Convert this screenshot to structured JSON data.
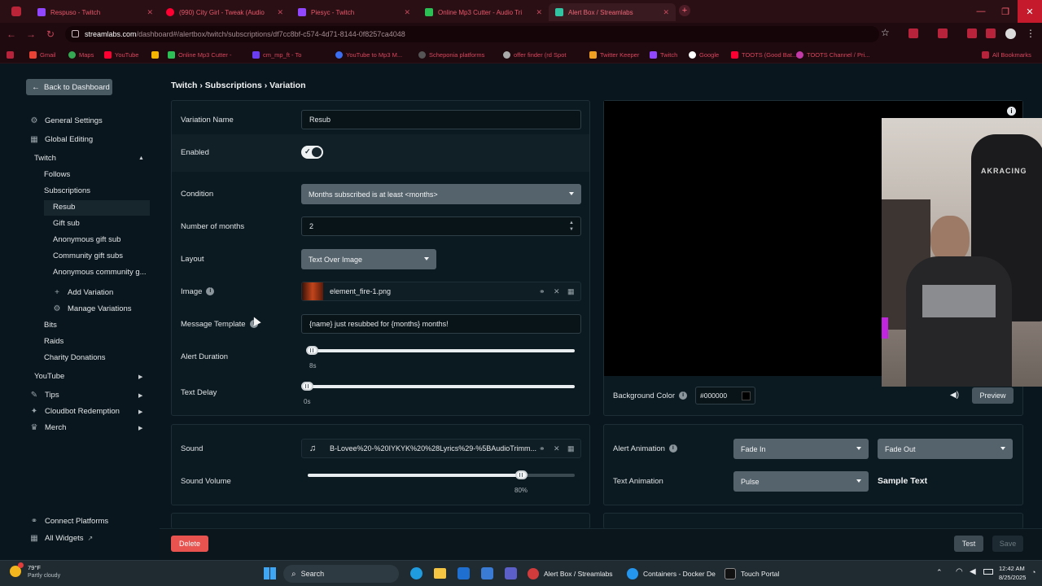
{
  "browser": {
    "tabs": [
      {
        "label": "Respuso - Twitch",
        "color": "#9146ff"
      },
      {
        "label": "(990) City Girl - Tweak (Audio",
        "color": "#ff0033"
      },
      {
        "label": "Piesyc - Twitch",
        "color": "#9146ff"
      },
      {
        "label": "Online Mp3 Cutter - Audio Tri",
        "color": "#2bbf55"
      },
      {
        "label": "Alert Box / Streamlabs",
        "color": "#31c3a2"
      }
    ],
    "new_tab": "+",
    "url_host": "streamlabs.com",
    "url_path": "/dashboard#/alertbox/twitch/subscriptions/df7cc8bf-c574-4d71-8144-0f8257ca4048",
    "bookmarks": [
      "Gmail",
      "Maps",
      "YouTube",
      "Online Mp3 Cutter -",
      "cm_mp_ft - To",
      "YouTube to Mp3 M...",
      "Scheponia platforms",
      "offer finder (rd Spot",
      "Twitter Keeper",
      "Twitch",
      "Google",
      "TOOTS (Good Bat...",
      "TOOTS Channel / Pri..."
    ],
    "all_bookmarks": "All Bookmarks",
    "win_controls": [
      "—",
      "❐",
      "✕"
    ]
  },
  "app": {
    "back_button": "Back to Dashboard",
    "breadcrumb": "Twitch › Subscriptions › Variation",
    "sidebar": {
      "general_settings": "General Settings",
      "global_editing": "Global Editing",
      "twitch": "Twitch",
      "follows": "Follows",
      "subscriptions": "Subscriptions",
      "resub": "Resub",
      "gift_sub": "Gift sub",
      "anonymous_gift_sub": "Anonymous gift sub",
      "community_gift_subs": "Community gift subs",
      "anonymous_community": "Anonymous community g...",
      "add_variation": "Add Variation",
      "manage_variations": "Manage Variations",
      "bits": "Bits",
      "raids": "Raids",
      "charity_donations": "Charity Donations",
      "youtube": "YouTube",
      "tips": "Tips",
      "cloudbot": "Cloudbot Redemption",
      "merch": "Merch",
      "connect_platforms": "Connect Platforms",
      "all_widgets": "All Widgets"
    },
    "form": {
      "variation_name_label": "Variation Name",
      "variation_name_value": "Resub",
      "enabled_label": "Enabled",
      "enabled": true,
      "condition_label": "Condition",
      "condition_value": "Months subscribed is at least <months>",
      "months_label": "Number of months",
      "months_value": "2",
      "layout_label": "Layout",
      "layout_value": "Text Over Image",
      "image_label": "Image",
      "image_file": "element_fire-1.png",
      "message_label": "Message Template",
      "message_value": "{name} just resubbed for {months} months!",
      "alert_duration_label": "Alert Duration",
      "alert_duration_value": "8s",
      "alert_duration_fraction": 0.0,
      "text_delay_label": "Text Delay",
      "text_delay_value": "0s",
      "text_delay_fraction": 0.0,
      "sound_label": "Sound",
      "sound_file": "B-Lovee%20-%20IYKYK%20%28Lyrics%29-%5BAudioTrimm...",
      "sound_volume_label": "Sound Volume",
      "sound_volume_value": "80%",
      "sound_volume_fraction": 0.8
    },
    "preview": {
      "background_color_label": "Background Color",
      "background_color_value": "#000000",
      "preview_button": "Preview",
      "alert_animation_label": "Alert Animation",
      "alert_animation_in": "Fade In",
      "alert_animation_out": "Fade Out",
      "text_animation_label": "Text Animation",
      "text_animation_value": "Pulse",
      "sample_text": "Sample Text"
    },
    "footer": {
      "delete": "Delete",
      "test": "Test",
      "save": "Save"
    }
  },
  "taskbar": {
    "weather_temp": "79°F",
    "weather_desc": "Partly cloudy",
    "search": "Search",
    "apps": [
      "Alert Box / Streamlabs",
      "Containers - Docker De",
      "Touch Portal"
    ],
    "time": "12:42 AM",
    "date": "8/25/2025"
  },
  "colors": {
    "accent_delete": "#e8524f",
    "accent_twitch": "#9146ff",
    "panel_bg": "#0b1920"
  }
}
